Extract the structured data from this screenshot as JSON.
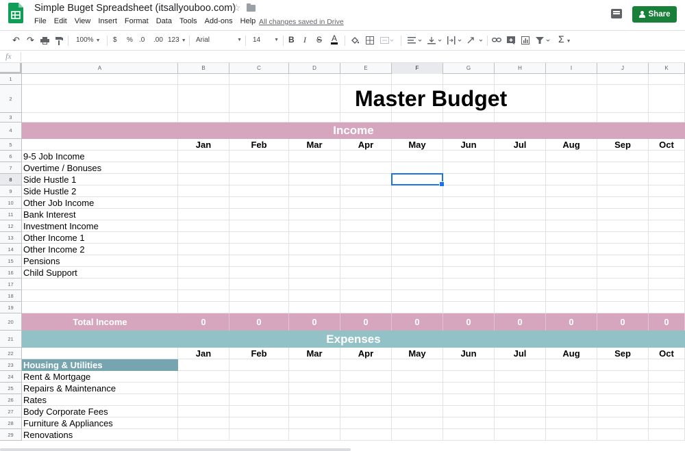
{
  "app": {
    "title": "Simple Buget Spreadsheet (itsallyouboo.com)",
    "save_status": "All changes saved in Drive",
    "share_label": "Share",
    "menus": [
      "File",
      "Edit",
      "View",
      "Insert",
      "Format",
      "Data",
      "Tools",
      "Add-ons",
      "Help"
    ]
  },
  "toolbar": {
    "zoom": "100%",
    "currency": "$",
    "percent": "%",
    "decrease_decimals": ".0",
    "increase_decimals": ".00",
    "more_formats": "123",
    "font": "Arial",
    "font_size": "14",
    "bold": "B",
    "italic": "I",
    "strike": "S",
    "text_color": "A",
    "functions": "Σ"
  },
  "formula_bar": {
    "icon": "fx",
    "value": ""
  },
  "columns": [
    "A",
    "B",
    "C",
    "D",
    "E",
    "F",
    "G",
    "H",
    "I",
    "J",
    "K"
  ],
  "selected_column": "F",
  "selected_row": 8,
  "rows": [
    "1",
    "2",
    "3",
    "4",
    "5",
    "6",
    "7",
    "8",
    "9",
    "10",
    "11",
    "12",
    "13",
    "14",
    "15",
    "16",
    "17",
    "18",
    "19",
    "20",
    "21",
    "22",
    "23",
    "24",
    "25",
    "26",
    "27",
    "28",
    "29"
  ],
  "sheet": {
    "title": "Master Budget",
    "income_header": "Income",
    "expenses_header": "Expenses",
    "months": [
      "Jan",
      "Feb",
      "Mar",
      "Apr",
      "May",
      "Jun",
      "Jul",
      "Aug",
      "Sep",
      "Oct"
    ],
    "income_items": [
      "9-5 Job Income",
      "Overtime / Bonuses",
      "Side Hustle 1",
      "Side Hustle 2",
      "Other Job Income",
      "Bank Interest",
      "Investment Income",
      "Other Income 1",
      "Other Income 2",
      "Pensions",
      "Child Support"
    ],
    "total_income_label": "Total Income",
    "total_income_values": [
      "0",
      "0",
      "0",
      "0",
      "0",
      "0",
      "0",
      "0",
      "0",
      "0"
    ],
    "housing_label": "Housing & Utilities",
    "expense_items": [
      "Rent & Mortgage",
      "Repairs & Maintenance",
      "Rates",
      "Body Corporate Fees",
      "Furniture & Appliances",
      "Renovations"
    ]
  },
  "colors": {
    "income_band": "#d5a6bd",
    "expenses_band": "#93c2c6",
    "housing_band": "#76a5af",
    "share_button": "#188038",
    "selection": "#1a73e8"
  }
}
